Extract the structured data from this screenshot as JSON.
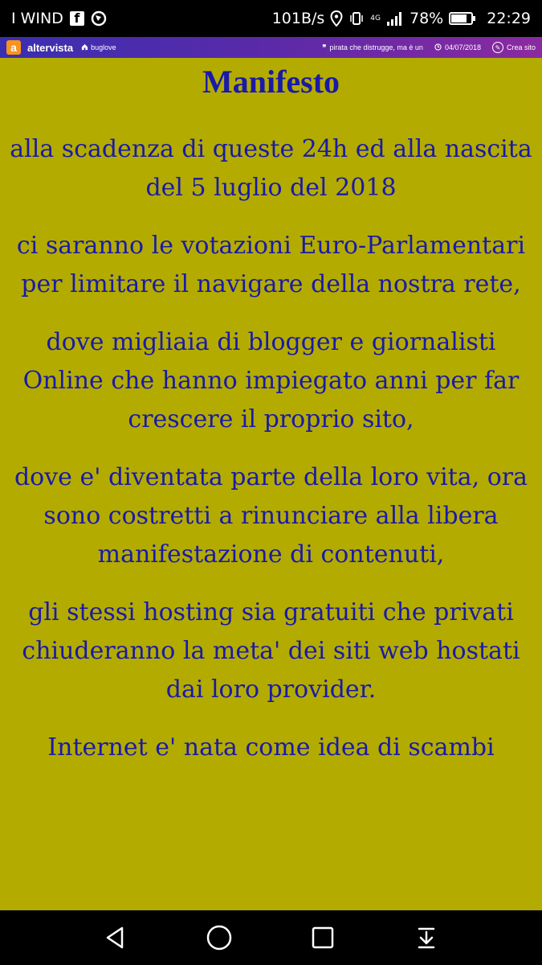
{
  "status": {
    "carrier": "I WIND",
    "speed": "101B/s",
    "network": "4G",
    "battery": "78%",
    "battery_level": 0.78,
    "time": "22:29"
  },
  "site_bar": {
    "brand": "altervista",
    "site": "buglove",
    "quote": "pirata che distrugge, ma è un",
    "date": "04/07/2018",
    "create": "Crea sito"
  },
  "content": {
    "title": "Manifesto",
    "paragraphs": [
      "alla scadenza di queste 24h ed alla nascita del 5 luglio del 2018",
      "ci saranno le votazioni Euro-Parlamentari per limitare il navigare della nostra rete,",
      "dove migliaia di blogger e giornalisti Online che hanno impiegato anni per far crescere il proprio sito,",
      "dove e' diventata parte della loro vita, ora sono costretti a rinunciare alla libera manifestazione di contenuti,",
      "gli stessi hosting sia gratuiti che privati chiuderanno la meta' dei siti web hostati dai loro provider.",
      "Internet e' nata come idea di scambi"
    ]
  },
  "colors": {
    "background": "#b3ab00",
    "text": "#1a1aa8"
  }
}
